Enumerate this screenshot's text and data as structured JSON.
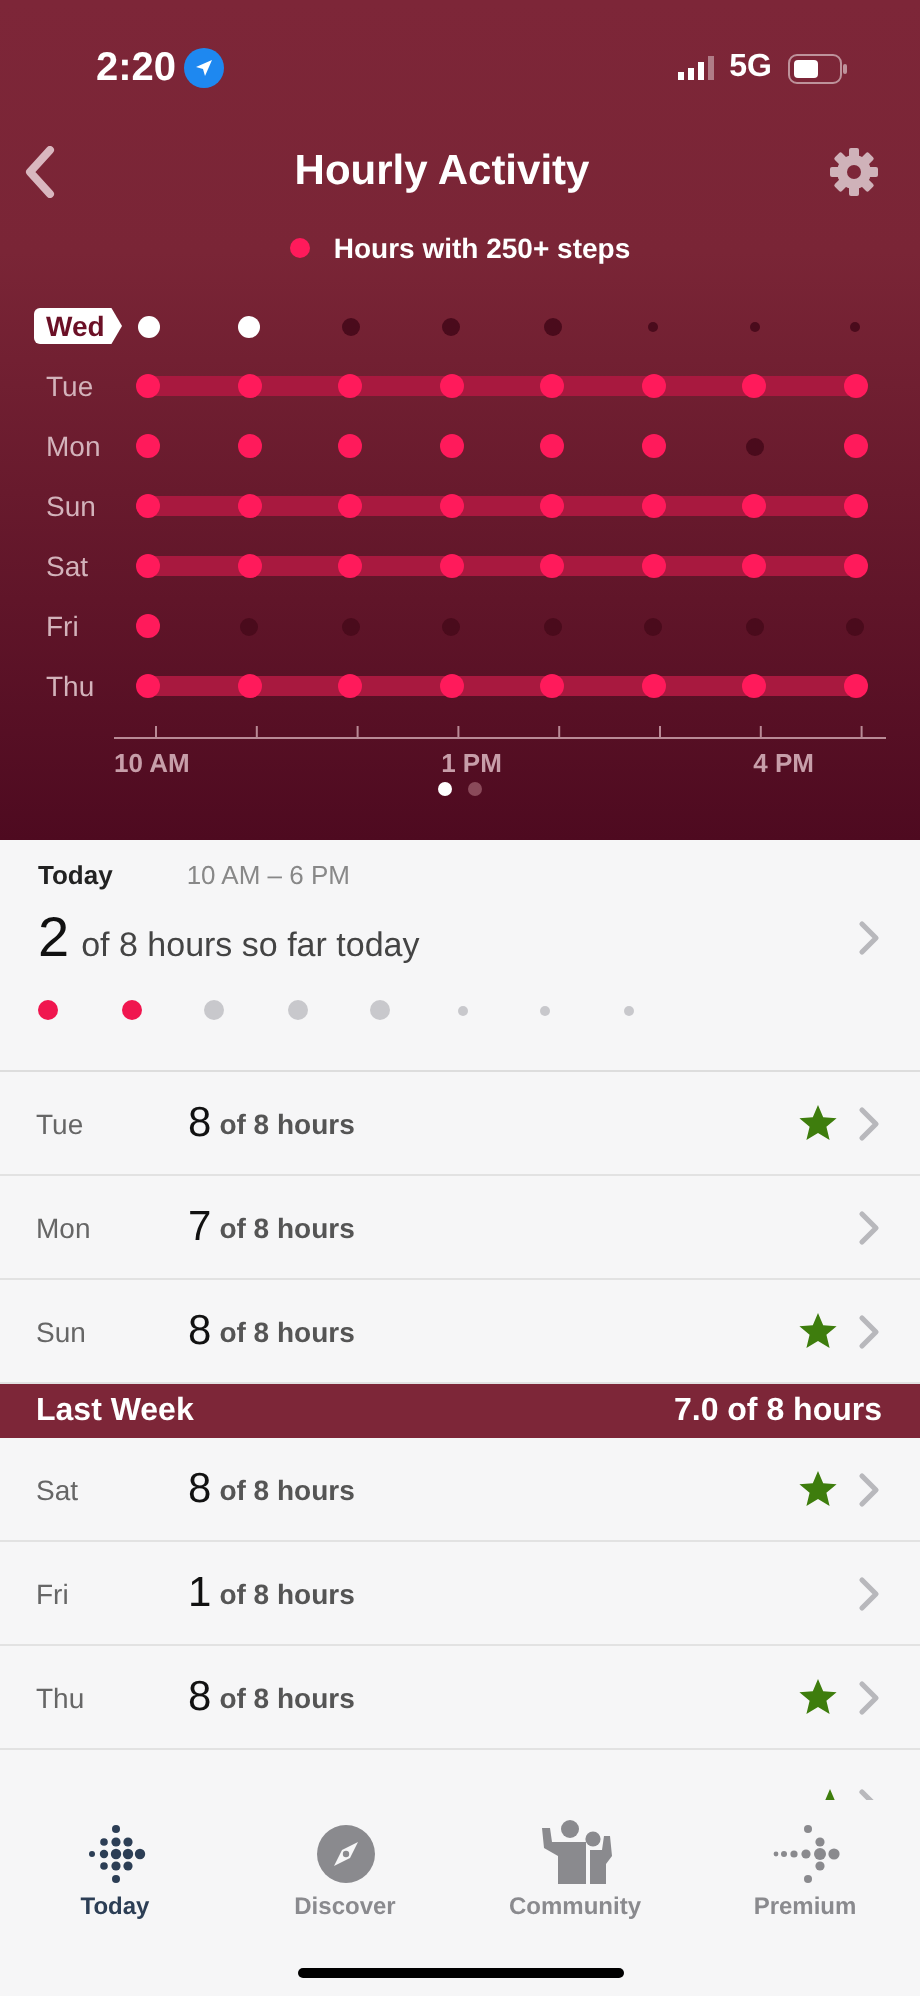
{
  "status_bar": {
    "time": "2:20",
    "network": "5G"
  },
  "nav": {
    "title": "Hourly Activity"
  },
  "legend": {
    "label": "Hours with 250+ steps"
  },
  "grid": {
    "rows": [
      {
        "day": "Wed",
        "selected": true,
        "hours": [
          {
            "hit": true,
            "future": false
          },
          {
            "hit": true,
            "future": false
          },
          {
            "hit": false,
            "future": false
          },
          {
            "hit": false,
            "future": false
          },
          {
            "hit": false,
            "future": false
          },
          {
            "hit": false,
            "future": true
          },
          {
            "hit": false,
            "future": true
          },
          {
            "hit": false,
            "future": true
          }
        ]
      },
      {
        "day": "Tue",
        "selected": false,
        "hours": [
          {
            "hit": true,
            "future": false
          },
          {
            "hit": true,
            "future": false
          },
          {
            "hit": true,
            "future": false
          },
          {
            "hit": true,
            "future": false
          },
          {
            "hit": true,
            "future": false
          },
          {
            "hit": true,
            "future": false
          },
          {
            "hit": true,
            "future": false
          },
          {
            "hit": true,
            "future": false
          }
        ]
      },
      {
        "day": "Mon",
        "selected": false,
        "hours": [
          {
            "hit": true,
            "future": false
          },
          {
            "hit": true,
            "future": false
          },
          {
            "hit": true,
            "future": false
          },
          {
            "hit": true,
            "future": false
          },
          {
            "hit": true,
            "future": false
          },
          {
            "hit": true,
            "future": false
          },
          {
            "hit": false,
            "future": false
          },
          {
            "hit": true,
            "future": false
          }
        ]
      },
      {
        "day": "Sun",
        "selected": false,
        "hours": [
          {
            "hit": true,
            "future": false
          },
          {
            "hit": true,
            "future": false
          },
          {
            "hit": true,
            "future": false
          },
          {
            "hit": true,
            "future": false
          },
          {
            "hit": true,
            "future": false
          },
          {
            "hit": true,
            "future": false
          },
          {
            "hit": true,
            "future": false
          },
          {
            "hit": true,
            "future": false
          }
        ]
      },
      {
        "day": "Sat",
        "selected": false,
        "hours": [
          {
            "hit": true,
            "future": false
          },
          {
            "hit": true,
            "future": false
          },
          {
            "hit": true,
            "future": false
          },
          {
            "hit": true,
            "future": false
          },
          {
            "hit": true,
            "future": false
          },
          {
            "hit": true,
            "future": false
          },
          {
            "hit": true,
            "future": false
          },
          {
            "hit": true,
            "future": false
          }
        ]
      },
      {
        "day": "Fri",
        "selected": false,
        "hours": [
          {
            "hit": true,
            "future": false
          },
          {
            "hit": false,
            "future": false
          },
          {
            "hit": false,
            "future": false
          },
          {
            "hit": false,
            "future": false
          },
          {
            "hit": false,
            "future": false
          },
          {
            "hit": false,
            "future": false
          },
          {
            "hit": false,
            "future": false
          },
          {
            "hit": false,
            "future": false
          }
        ]
      },
      {
        "day": "Thu",
        "selected": false,
        "hours": [
          {
            "hit": true,
            "future": false
          },
          {
            "hit": true,
            "future": false
          },
          {
            "hit": true,
            "future": false
          },
          {
            "hit": true,
            "future": false
          },
          {
            "hit": true,
            "future": false
          },
          {
            "hit": true,
            "future": false
          },
          {
            "hit": true,
            "future": false
          },
          {
            "hit": true,
            "future": false
          }
        ]
      }
    ],
    "axis_labels": [
      "10 AM",
      "1 PM",
      "4 PM"
    ],
    "pages": [
      {
        "selected": true
      },
      {
        "selected": false
      }
    ]
  },
  "today": {
    "label": "Today",
    "range": "10 AM – 6 PM",
    "count": "2",
    "summary": "of 8 hours so far today",
    "hours": [
      {
        "hit": true,
        "future": false
      },
      {
        "hit": true,
        "future": false
      },
      {
        "hit": false,
        "future": false
      },
      {
        "hit": false,
        "future": false
      },
      {
        "hit": false,
        "future": false
      },
      {
        "hit": false,
        "future": true
      },
      {
        "hit": false,
        "future": true
      },
      {
        "hit": false,
        "future": true
      }
    ]
  },
  "this_week": [
    {
      "day": "Tue",
      "count": "8",
      "of": "of 8 hours",
      "star": true
    },
    {
      "day": "Mon",
      "count": "7",
      "of": "of 8 hours",
      "star": false
    },
    {
      "day": "Sun",
      "count": "8",
      "of": "of 8 hours",
      "star": true
    }
  ],
  "last_week": {
    "title": "Last Week",
    "average": "7.0 of 8 hours",
    "rows": [
      {
        "kind": "full",
        "day": "Sat",
        "count": "8",
        "of": "of 8 hours",
        "star": true
      },
      {
        "kind": "full",
        "day": "Fri",
        "count": "1",
        "of": "of 8 hours",
        "star": false
      },
      {
        "kind": "full",
        "day": "Thu",
        "count": "8",
        "of": "of 8 hours",
        "star": true
      },
      {
        "kind": "partial",
        "star": true
      }
    ]
  },
  "tab_bar": [
    {
      "label": "Today",
      "kind": "today",
      "selected": true
    },
    {
      "label": "Discover",
      "kind": "discover",
      "selected": false
    },
    {
      "label": "Community",
      "kind": "community",
      "selected": false
    },
    {
      "label": "Premium",
      "kind": "premium",
      "selected": false
    }
  ]
}
